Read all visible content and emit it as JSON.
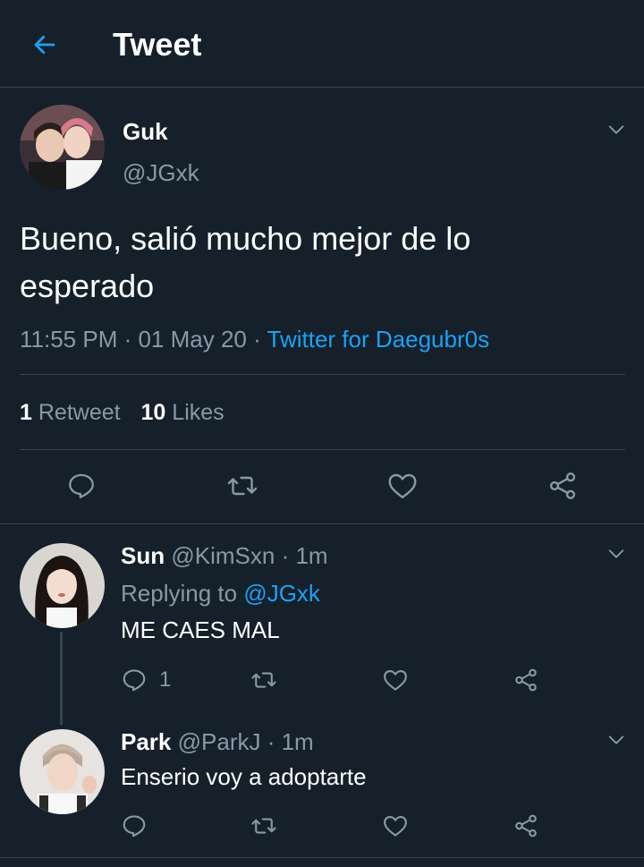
{
  "header": {
    "title": "Tweet"
  },
  "main_tweet": {
    "name": "Guk",
    "handle": "@JGxk",
    "text_line1": "Bueno, salió mucho mejor de lo",
    "text_line2": "esperado",
    "time": "11:55 PM",
    "sep1": " · ",
    "date": "01 May 20",
    "sep2": " · ",
    "source": "Twitter for Daegubr0s",
    "retweet_count": "1",
    "retweet_label": "Retweet",
    "like_count": "10",
    "like_label": "Likes"
  },
  "replies": [
    {
      "name": "Sun",
      "handle": "@KimSxn",
      "time": "· 1m",
      "replying_prefix": "Replying to ",
      "replying_to": "@JGxk",
      "text": "ME CAES MAL",
      "reply_count": "1"
    },
    {
      "name": "Park",
      "handle": "@ParkJ",
      "time": "· 1m",
      "text": "Enserio voy a adoptarte"
    }
  ],
  "colors": {
    "background": "#15202b",
    "accent": "#1da1f2",
    "muted": "#8899a6",
    "divider": "#38444d"
  },
  "icons": [
    "back-arrow-icon",
    "chevron-down-icon",
    "reply-icon",
    "retweet-icon",
    "like-icon",
    "share-icon"
  ]
}
